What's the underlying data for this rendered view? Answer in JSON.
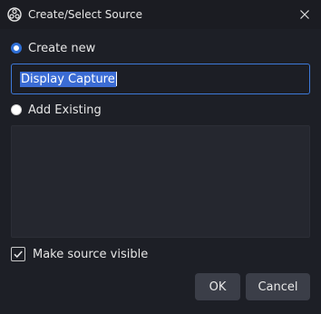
{
  "window": {
    "title": "Create/Select Source",
    "app_icon": "obs-logo-icon",
    "close_icon": "close-icon"
  },
  "options": {
    "create_new_label": "Create new",
    "create_new_selected": true,
    "add_existing_label": "Add Existing",
    "add_existing_selected": false
  },
  "name_input": {
    "value": "Display Capture",
    "text_selected": true
  },
  "existing_sources": {
    "items": []
  },
  "visibility": {
    "label": "Make source visible",
    "checked": true
  },
  "buttons": {
    "ok_label": "OK",
    "cancel_label": "Cancel"
  },
  "colors": {
    "background": "#1d1f26",
    "accent": "#3d79d9",
    "selection": "#3b6cd4",
    "button": "#3b3e48"
  }
}
